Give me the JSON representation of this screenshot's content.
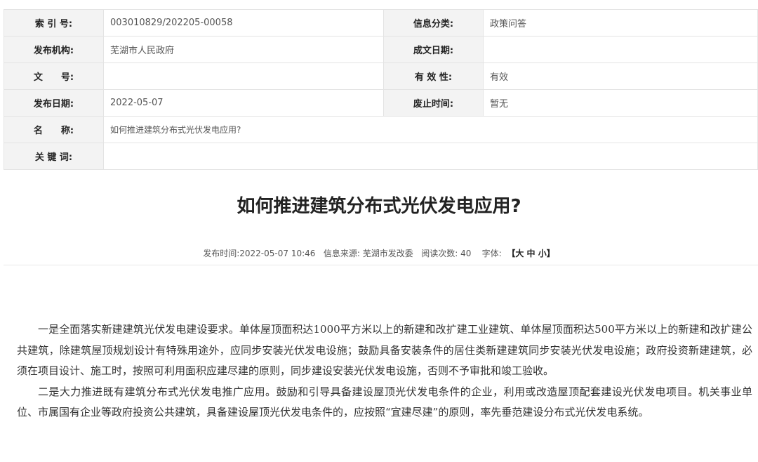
{
  "meta": {
    "rows": [
      {
        "l1": "索 引 号:",
        "v1": "003010829/202205-00058",
        "l2": "信息分类:",
        "v2": "政策问答"
      },
      {
        "l1": "发布机构:",
        "v1": "芜湖市人民政府",
        "l2": "成文日期:",
        "v2": ""
      },
      {
        "l1": "文　　号:",
        "v1": "",
        "l2": "有 效 性:",
        "v2": "有效"
      },
      {
        "l1": "发布日期:",
        "v1": "2022-05-07",
        "l2": "废止时间:",
        "v2": "暂无"
      }
    ],
    "name_label": "名　　称:",
    "name_value": "如何推进建筑分布式光伏发电应用?",
    "keyword_label": "关 键 词:",
    "keyword_value": ""
  },
  "article": {
    "title": "如何推进建筑分布式光伏发电应用?",
    "publish_label": "发布时间:",
    "publish_time": "2022-05-07 10:46",
    "source_label": "信息来源:",
    "source": "芜湖市发改委",
    "views_label": "阅读次数:",
    "views": "40",
    "font_label": "字体:",
    "font_open": "【",
    "font_large": "大",
    "font_medium": "中",
    "font_small": "小",
    "font_close": "】",
    "paragraphs": [
      "一是全面落实新建建筑光伏发电建设要求。单体屋顶面积达1000平方米以上的新建和改扩建工业建筑、单体屋顶面积达500平方米以上的新建和改扩建公共建筑，除建筑屋顶规划设计有特殊用途外，应同步安装光伏发电设施；鼓励具备安装条件的居住类新建建筑同步安装光伏发电设施；政府投资新建建筑，必须在项目设计、施工时，按照可利用面积应建尽建的原则，同步建设安装光伏发电设施，否则不予审批和竣工验收。",
      "二是大力推进既有建筑分布式光伏发电推广应用。鼓励和引导具备建设屋顶光伏发电条件的企业，利用或改造屋顶配套建设光伏发电项目。机关事业单位、市属国有企业等政府投资公共建筑，具备建设屋顶光伏发电条件的，应按照“宜建尽建”的原则，率先垂范建设分布式光伏发电系统。"
    ]
  }
}
